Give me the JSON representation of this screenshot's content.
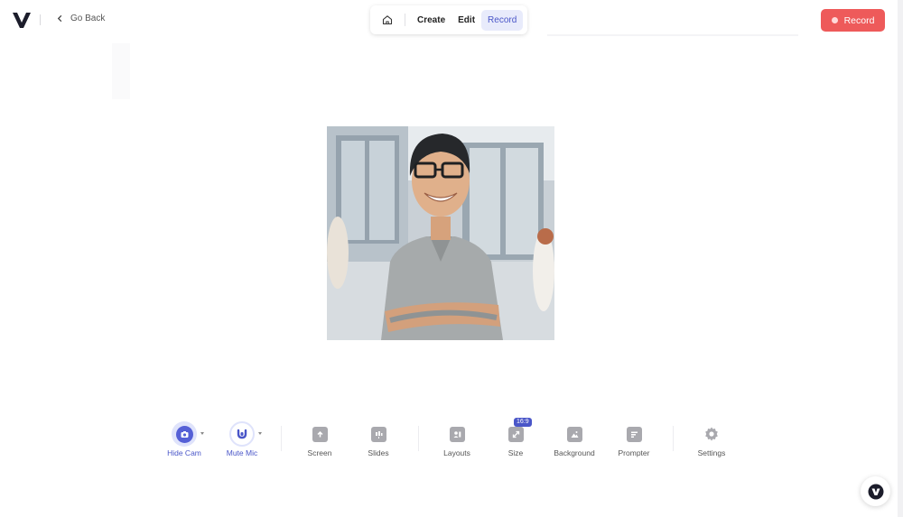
{
  "header": {
    "back_label": "Go Back",
    "modes": [
      {
        "label": "Create",
        "active": false
      },
      {
        "label": "Edit",
        "active": false
      },
      {
        "label": "Record",
        "active": true
      }
    ],
    "record_label": "Record"
  },
  "preview": {
    "icon": "camera-preview"
  },
  "toolbar": {
    "items": [
      {
        "label": "Hide Cam",
        "icon": "camera-icon",
        "state": "on"
      },
      {
        "label": "Mute Mic",
        "icon": "microphone-icon",
        "state": "on"
      },
      {
        "label": "Screen",
        "icon": "screen-share-icon"
      },
      {
        "label": "Slides",
        "icon": "slides-icon"
      },
      {
        "label": "Layouts",
        "icon": "layouts-icon"
      },
      {
        "label": "Size",
        "icon": "resize-icon",
        "badge": "16:9"
      },
      {
        "label": "Background",
        "icon": "background-image-icon"
      },
      {
        "label": "Prompter",
        "icon": "prompter-icon"
      },
      {
        "label": "Settings",
        "icon": "gear-icon"
      }
    ]
  },
  "colors": {
    "accent": "#4a56c8",
    "record": "#ee5a5a"
  }
}
